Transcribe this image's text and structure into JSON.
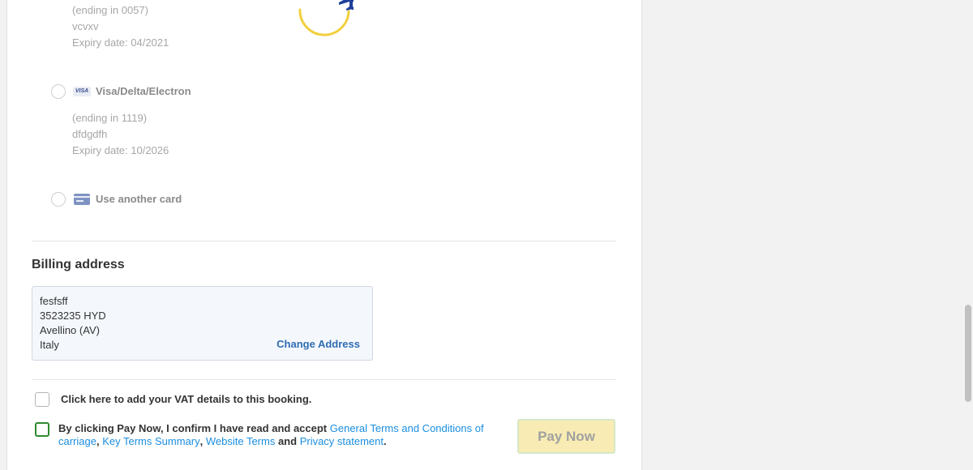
{
  "cards": [
    {
      "label": "",
      "ending": "(ending in 0057)",
      "name": "vcvxv",
      "expiry": "Expiry date: 04/2021"
    },
    {
      "label": "Visa/Delta/Electron",
      "brand_badge": "VISA",
      "ending": "(ending in 1119)",
      "name": "dfdgdfh",
      "expiry": "Expiry date: 10/2026"
    }
  ],
  "another_card_label": "Use another card",
  "billing": {
    "title": "Billing address",
    "lines": [
      "fesfsff",
      "3523235 HYD",
      "Avellino (AV)",
      "Italy"
    ],
    "change_label": "Change Address"
  },
  "vat_label": "Click here to add your VAT details to this booking.",
  "terms": {
    "prefix": "By clicking Pay Now, I confirm I have read and accept ",
    "link1": "General Terms and Conditions of carriage",
    "sep1": ", ",
    "link2": "Key Terms Summary",
    "sep2": ", ",
    "link3": "Website Terms",
    "and": " and ",
    "link4": "Privacy statement",
    "end": "."
  },
  "pay_now_label": "Pay Now",
  "colors": {
    "link": "#1a8ee0",
    "change_link": "#2f6cb3",
    "pay_bg": "#f8ecb4",
    "checkbox_green": "#2e8b2e",
    "loader_yellow": "#f2cf3d",
    "plane_blue": "#1e3f9a"
  }
}
